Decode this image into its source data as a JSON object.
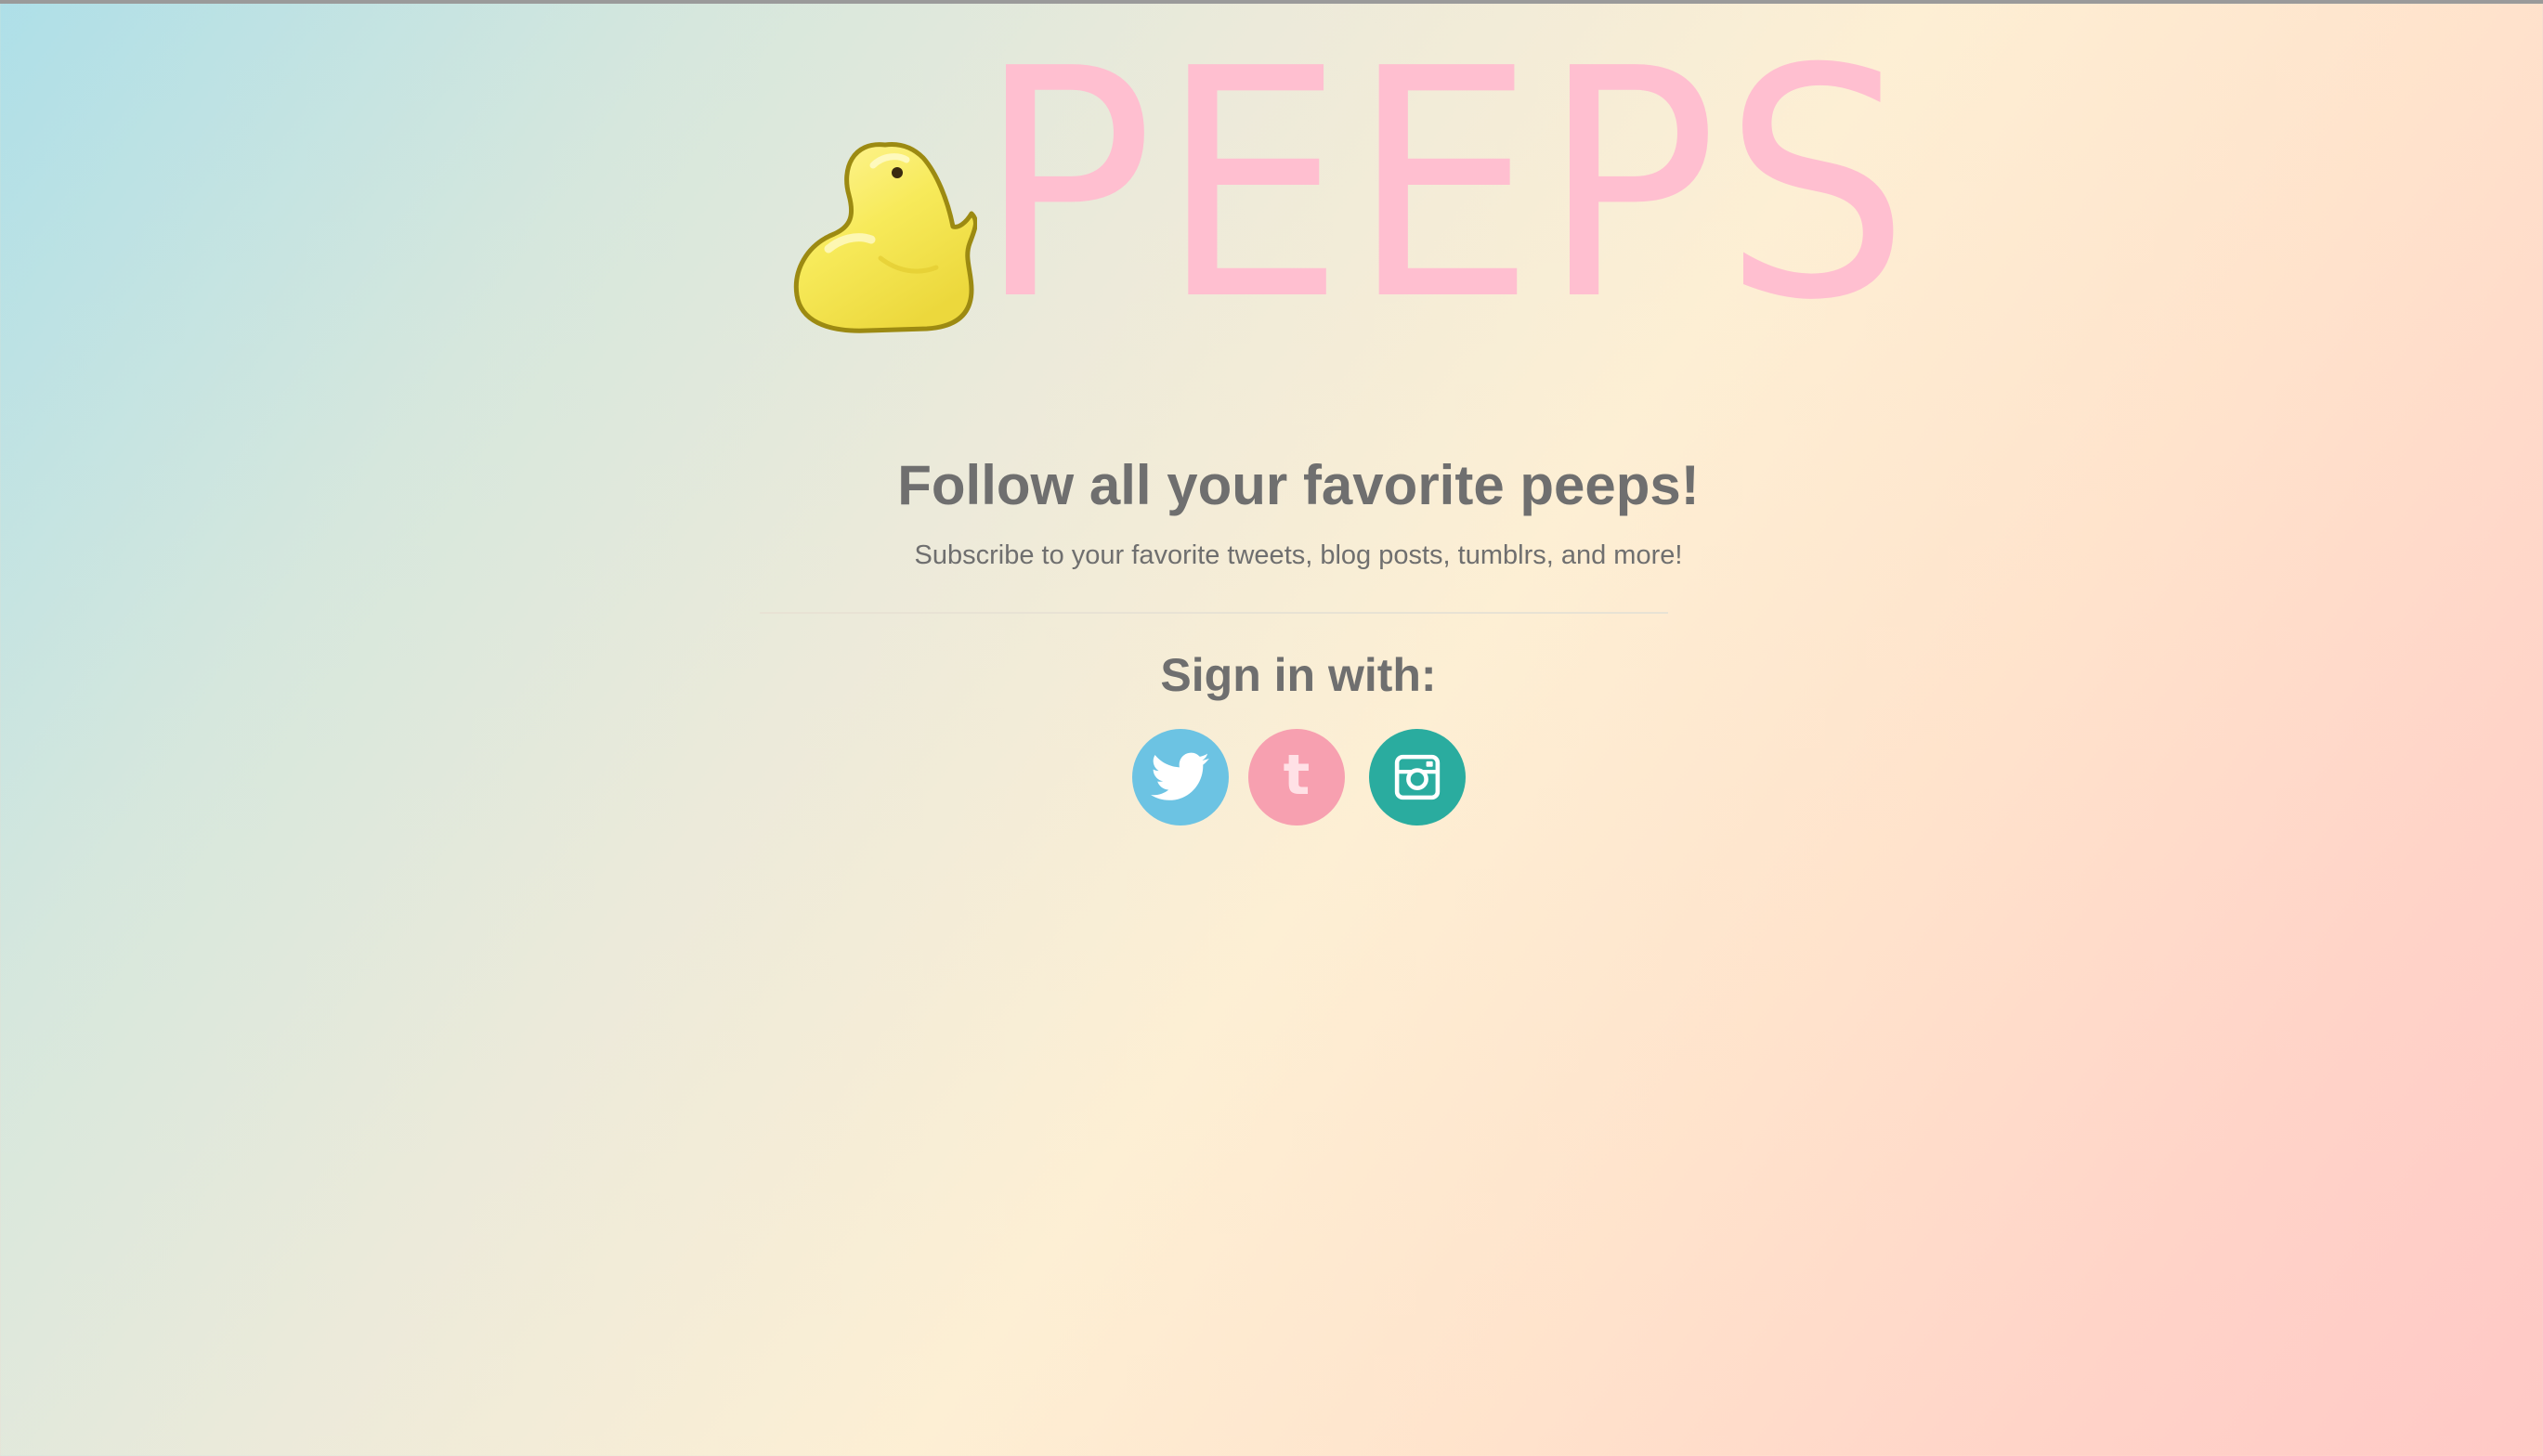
{
  "logo": {
    "wordmark": "PEEPS",
    "mascot_icon": "yellow-chick-icon"
  },
  "hero": {
    "headline": "Follow all your favorite peeps!",
    "subheadline": "Subscribe to your favorite tweets, blog posts, tumblrs, and more!"
  },
  "signin": {
    "title": "Sign in with:",
    "providers": [
      {
        "name": "twitter",
        "icon": "twitter-bird-icon",
        "color": "#6cc3e3"
      },
      {
        "name": "tumblr",
        "icon": "tumblr-icon",
        "glyph": "t",
        "color": "#f7a0b0"
      },
      {
        "name": "instagram",
        "icon": "instagram-camera-icon",
        "color": "#2aac9f"
      }
    ]
  },
  "colors": {
    "wordmark": "#ffbfd0",
    "text": "#6f6f6f"
  }
}
